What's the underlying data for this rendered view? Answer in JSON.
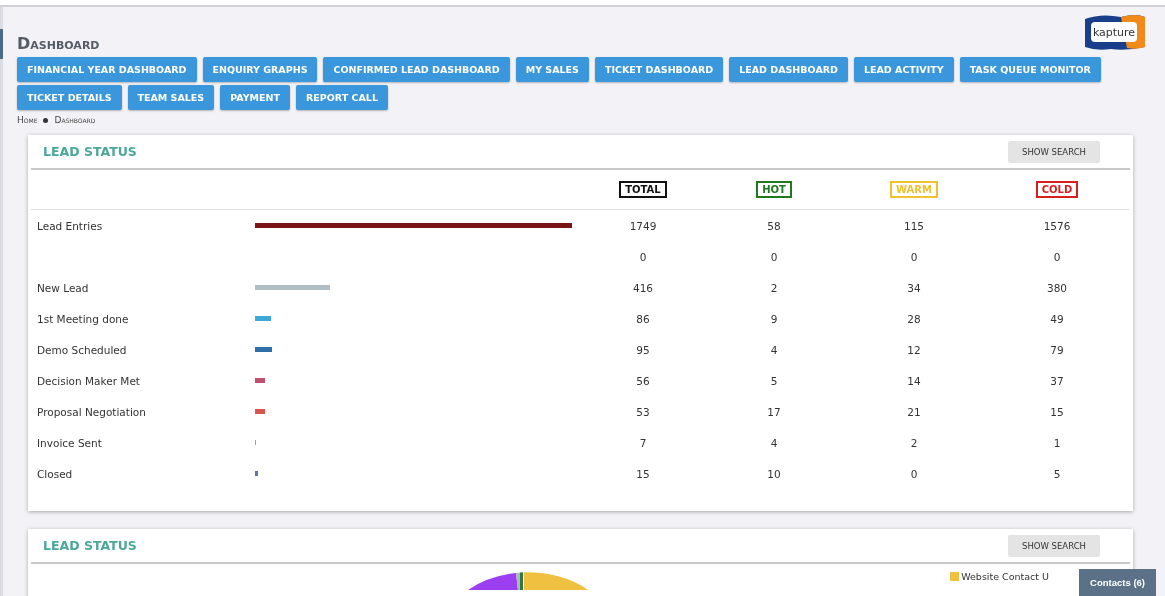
{
  "page_title": "Dashboard",
  "nav_buttons": [
    "FINANCIAL YEAR DASHBOARD",
    "ENQUIRY GRAPHS",
    "CONFIRMED LEAD DASHBOARD",
    "MY SALES",
    "TICKET DASHBOARD",
    "LEAD DASHBOARD",
    "LEAD ACTIVITY",
    "TASK QUEUE MONITOR",
    "TICKET DETAILS",
    "TEAM SALES",
    "PAYMENT",
    "REPORT CALL"
  ],
  "logo": {
    "text": "kapture"
  },
  "breadcrumb": [
    "Home",
    "Dashboard"
  ],
  "lead_status_table": {
    "title": "LEAD STATUS",
    "button": "SHOW SEARCH",
    "columns": [
      {
        "label": "TOTAL",
        "color": "#111111"
      },
      {
        "label": "HOT",
        "color": "#1f7a1f"
      },
      {
        "label": "WARM",
        "color": "#f2c12e"
      },
      {
        "label": "COLD",
        "color": "#d62020"
      }
    ],
    "rows": [
      {
        "name": "Lead Entries",
        "color": "#7b1414",
        "values": [
          "1749",
          "58",
          "115",
          "1576"
        ]
      },
      {
        "name": "",
        "values": [
          "0",
          "0",
          "0",
          "0"
        ]
      },
      {
        "name": "New Lead",
        "color": "#b0bec5",
        "values": [
          "416",
          "2",
          "34",
          "380"
        ]
      },
      {
        "name": "1st Meeting done",
        "color": "#3fa9d6",
        "values": [
          "86",
          "9",
          "28",
          "49"
        ]
      },
      {
        "name": "Demo Scheduled",
        "color": "#2f6fa8",
        "values": [
          "95",
          "4",
          "12",
          "79"
        ]
      },
      {
        "name": "Decision Maker Met",
        "color": "#c0506e",
        "values": [
          "56",
          "5",
          "14",
          "37"
        ]
      },
      {
        "name": "Proposal Negotiation",
        "color": "#d9534f",
        "values": [
          "53",
          "17",
          "21",
          "15"
        ]
      },
      {
        "name": "Invoice Sent",
        "color": "#f0883a",
        "values": [
          "7",
          "4",
          "2",
          "1"
        ]
      },
      {
        "name": "Closed",
        "color": "#6a6fb0",
        "values": [
          "15",
          "10",
          "0",
          "5"
        ]
      }
    ]
  },
  "lead_status_chart": {
    "title": "LEAD STATUS",
    "button": "SHOW SEARCH",
    "legend": [
      {
        "label": "Website Contact U",
        "color": "#f0c040"
      }
    ]
  },
  "contacts_button": "Contacts (6)"
}
